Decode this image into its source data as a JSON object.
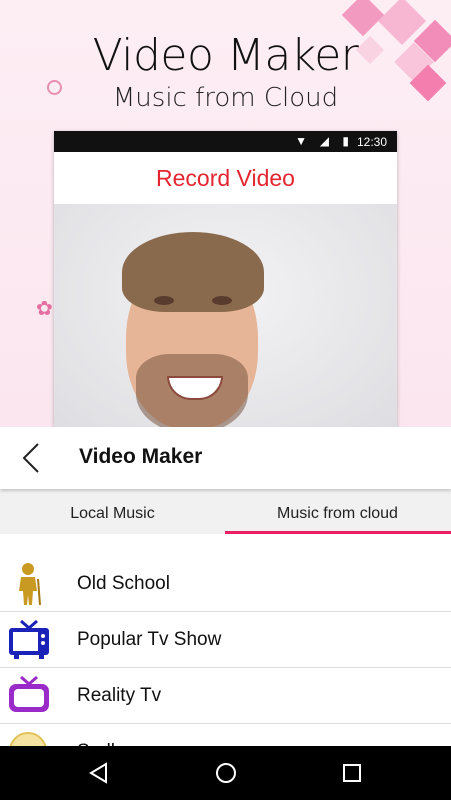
{
  "promo": {
    "headline": "Video Maker",
    "subheadline": "Music from Cloud",
    "phone": {
      "time": "12:30",
      "title": "Record Video"
    }
  },
  "header": {
    "back_icon": "chevron-left-icon",
    "title": "Video Maker"
  },
  "tabs": [
    {
      "label": "Local Music",
      "active": false
    },
    {
      "label": "Music from cloud",
      "active": true
    }
  ],
  "categories": [
    {
      "label": "Old School",
      "icon": "old-man-icon"
    },
    {
      "label": "Popular Tv Show",
      "icon": "tv-icon"
    },
    {
      "label": "Reality Tv",
      "icon": "tv-icon"
    },
    {
      "label": "Sadly",
      "icon": "sad-face-icon"
    }
  ],
  "navbar": {
    "back_icon": "nav-back-icon",
    "home_icon": "nav-home-icon",
    "recents_icon": "nav-recents-icon"
  },
  "colors": {
    "accent": "#e91e63",
    "record_title": "#e3262f",
    "tv_blue": "#1a22b8",
    "tv_purple": "#9b2bc9"
  }
}
